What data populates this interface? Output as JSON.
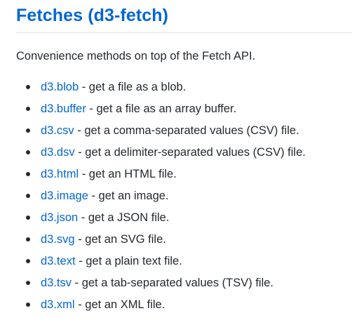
{
  "section": {
    "title": "Fetches (d3-fetch)",
    "intro": "Convenience methods on top of the Fetch API."
  },
  "items": [
    {
      "name": "d3.blob",
      "desc": " - get a file as a blob."
    },
    {
      "name": "d3.buffer",
      "desc": " - get a file as an array buffer."
    },
    {
      "name": "d3.csv",
      "desc": " - get a comma-separated values (CSV) file."
    },
    {
      "name": "d3.dsv",
      "desc": " - get a delimiter-separated values (CSV) file."
    },
    {
      "name": "d3.html",
      "desc": " - get an HTML file."
    },
    {
      "name": "d3.image",
      "desc": " - get an image."
    },
    {
      "name": "d3.json",
      "desc": " - get a JSON file."
    },
    {
      "name": "d3.svg",
      "desc": " - get an SVG file."
    },
    {
      "name": "d3.text",
      "desc": " - get a plain text file."
    },
    {
      "name": "d3.tsv",
      "desc": " - get a tab-separated values (TSV) file."
    },
    {
      "name": "d3.xml",
      "desc": " - get an XML file."
    }
  ]
}
